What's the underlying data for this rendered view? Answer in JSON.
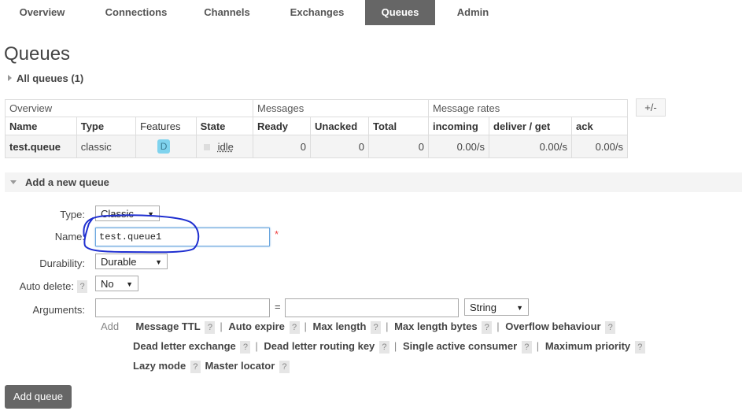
{
  "nav": {
    "tabs": [
      "Overview",
      "Connections",
      "Channels",
      "Exchanges",
      "Queues",
      "Admin"
    ],
    "active": "Queues"
  },
  "page": {
    "title": "Queues",
    "all_queues": "All queues (1)"
  },
  "table": {
    "groups": [
      "Overview",
      "Messages",
      "Message rates"
    ],
    "toggle_columns": "+/-",
    "headers": [
      "Name",
      "Type",
      "Features",
      "State",
      "Ready",
      "Unacked",
      "Total",
      "incoming",
      "deliver / get",
      "ack"
    ],
    "rows": [
      {
        "name": "test.queue",
        "type": "classic",
        "features": "D",
        "state": "idle",
        "ready": "0",
        "unacked": "0",
        "total": "0",
        "incoming": "0.00/s",
        "deliver_get": "0.00/s",
        "ack": "0.00/s"
      }
    ]
  },
  "add_queue": {
    "section_title": "Add a new queue",
    "type_label": "Type:",
    "type_value": "Classic",
    "name_label": "Name:",
    "name_value": "test.queue1",
    "required_mark": "*",
    "durability_label": "Durability:",
    "durability_value": "Durable",
    "auto_delete_label": "Auto delete:",
    "auto_delete_help": "?",
    "auto_delete_value": "No",
    "arguments_label": "Arguments:",
    "arguments_key": "",
    "arguments_eq": "=",
    "arguments_value": "",
    "arguments_type": "String",
    "add_label": "Add",
    "argument_links": [
      "Message TTL",
      "Auto expire",
      "Max length",
      "Max length bytes",
      "Overflow behaviour",
      "Dead letter exchange",
      "Dead letter routing key",
      "Single active consumer",
      "Maximum priority",
      "Lazy mode",
      "Master locator"
    ],
    "help_mark": "?",
    "separator": "|",
    "submit_label": "Add queue"
  },
  "colors": {
    "nav_active_bg": "#666666",
    "feature_badge": "#7fd3ee",
    "annotation_ink": "#1f2fd0"
  }
}
